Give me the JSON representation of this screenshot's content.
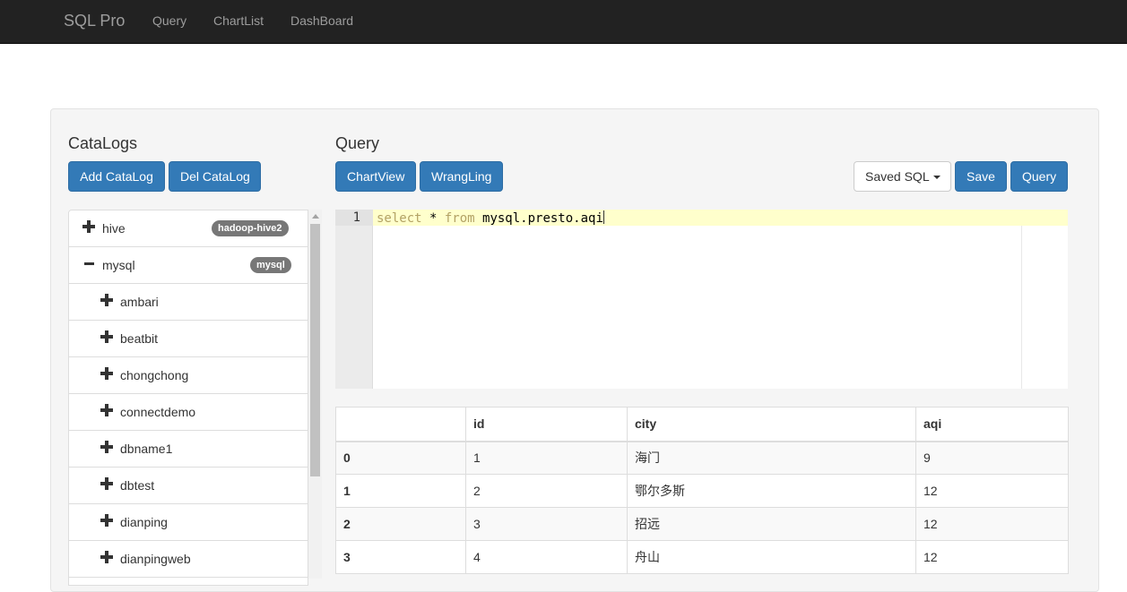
{
  "navbar": {
    "brand": "SQL Pro",
    "links": [
      "Query",
      "ChartList",
      "DashBoard"
    ]
  },
  "catalogs": {
    "title": "CataLogs",
    "add_label": "Add CataLog",
    "del_label": "Del CataLog",
    "items": [
      {
        "label": "hive",
        "badge": "hadoop-hive2",
        "expanded": false,
        "level": 0
      },
      {
        "label": "mysql",
        "badge": "mysql",
        "expanded": true,
        "level": 0
      },
      {
        "label": "ambari",
        "level": 1
      },
      {
        "label": "beatbit",
        "level": 1
      },
      {
        "label": "chongchong",
        "level": 1
      },
      {
        "label": "connectdemo",
        "level": 1
      },
      {
        "label": "dbname1",
        "level": 1
      },
      {
        "label": "dbtest",
        "level": 1
      },
      {
        "label": "dianping",
        "level": 1
      },
      {
        "label": "dianpingweb",
        "level": 1
      }
    ]
  },
  "query": {
    "title": "Query",
    "chartview_label": "ChartView",
    "wrangling_label": "WrangLing",
    "saved_sql_label": "Saved SQL",
    "save_label": "Save",
    "query_label": "Query"
  },
  "editor": {
    "line_number": "1",
    "tokens": [
      {
        "text": "select",
        "kw": true
      },
      {
        "text": " * ",
        "kw": false
      },
      {
        "text": "from",
        "kw": true
      },
      {
        "text": " mysql.presto.aqi",
        "kw": false
      }
    ]
  },
  "results": {
    "columns": [
      "",
      "id",
      "city",
      "aqi"
    ],
    "rows": [
      [
        "0",
        "1",
        "海门",
        "9"
      ],
      [
        "1",
        "2",
        "鄂尔多斯",
        "12"
      ],
      [
        "2",
        "3",
        "招远",
        "12"
      ],
      [
        "3",
        "4",
        "舟山",
        "12"
      ]
    ]
  },
  "colors": {
    "navbar_bg": "#222222",
    "primary": "#337ab7",
    "badge": "#777777",
    "active_line": "#ffffcc",
    "keyword": "#b3a265"
  }
}
